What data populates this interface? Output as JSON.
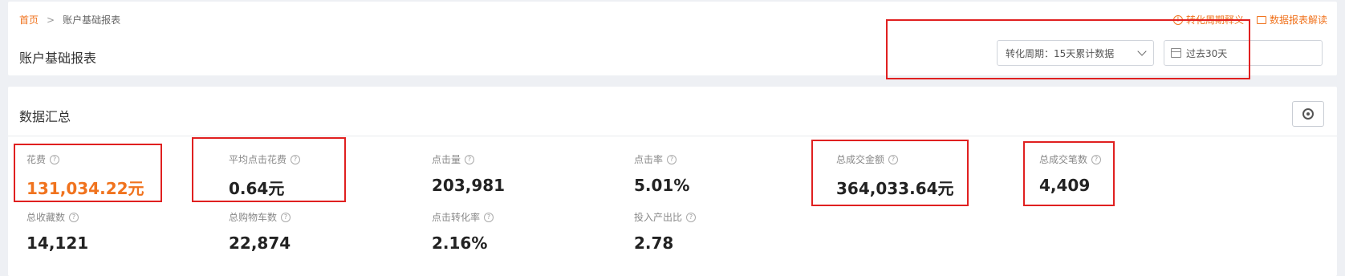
{
  "breadcrumb": {
    "home": "首页",
    "separator": ">",
    "current": "账户基础报表"
  },
  "page_title": "账户基础报表",
  "top_links": [
    {
      "label": "转化周期释义",
      "icon": "info-circle-icon"
    },
    {
      "label": "数据报表解读",
      "icon": "document-icon"
    }
  ],
  "filters": {
    "conversion_period": "转化周期：15天累计数据",
    "date_range": "过去30天"
  },
  "summary": {
    "title": "数据汇总",
    "metrics": [
      {
        "label": "花费",
        "value": "131,034.22元"
      },
      {
        "label": "平均点击花费",
        "value": "0.64元"
      },
      {
        "label": "点击量",
        "value": "203,981"
      },
      {
        "label": "点击率",
        "value": "5.01%"
      },
      {
        "label": "总成交金额",
        "value": "364,033.64元"
      },
      {
        "label": "总成交笔数",
        "value": "4,409"
      },
      {
        "label": "总收藏数",
        "value": "14,121"
      },
      {
        "label": "总购物车数",
        "value": "22,874"
      },
      {
        "label": "点击转化率",
        "value": "2.16%"
      },
      {
        "label": "投入产出比",
        "value": "2.78"
      }
    ]
  },
  "colors": {
    "accent": "#f0731e",
    "highlight_border": "#e02020"
  }
}
